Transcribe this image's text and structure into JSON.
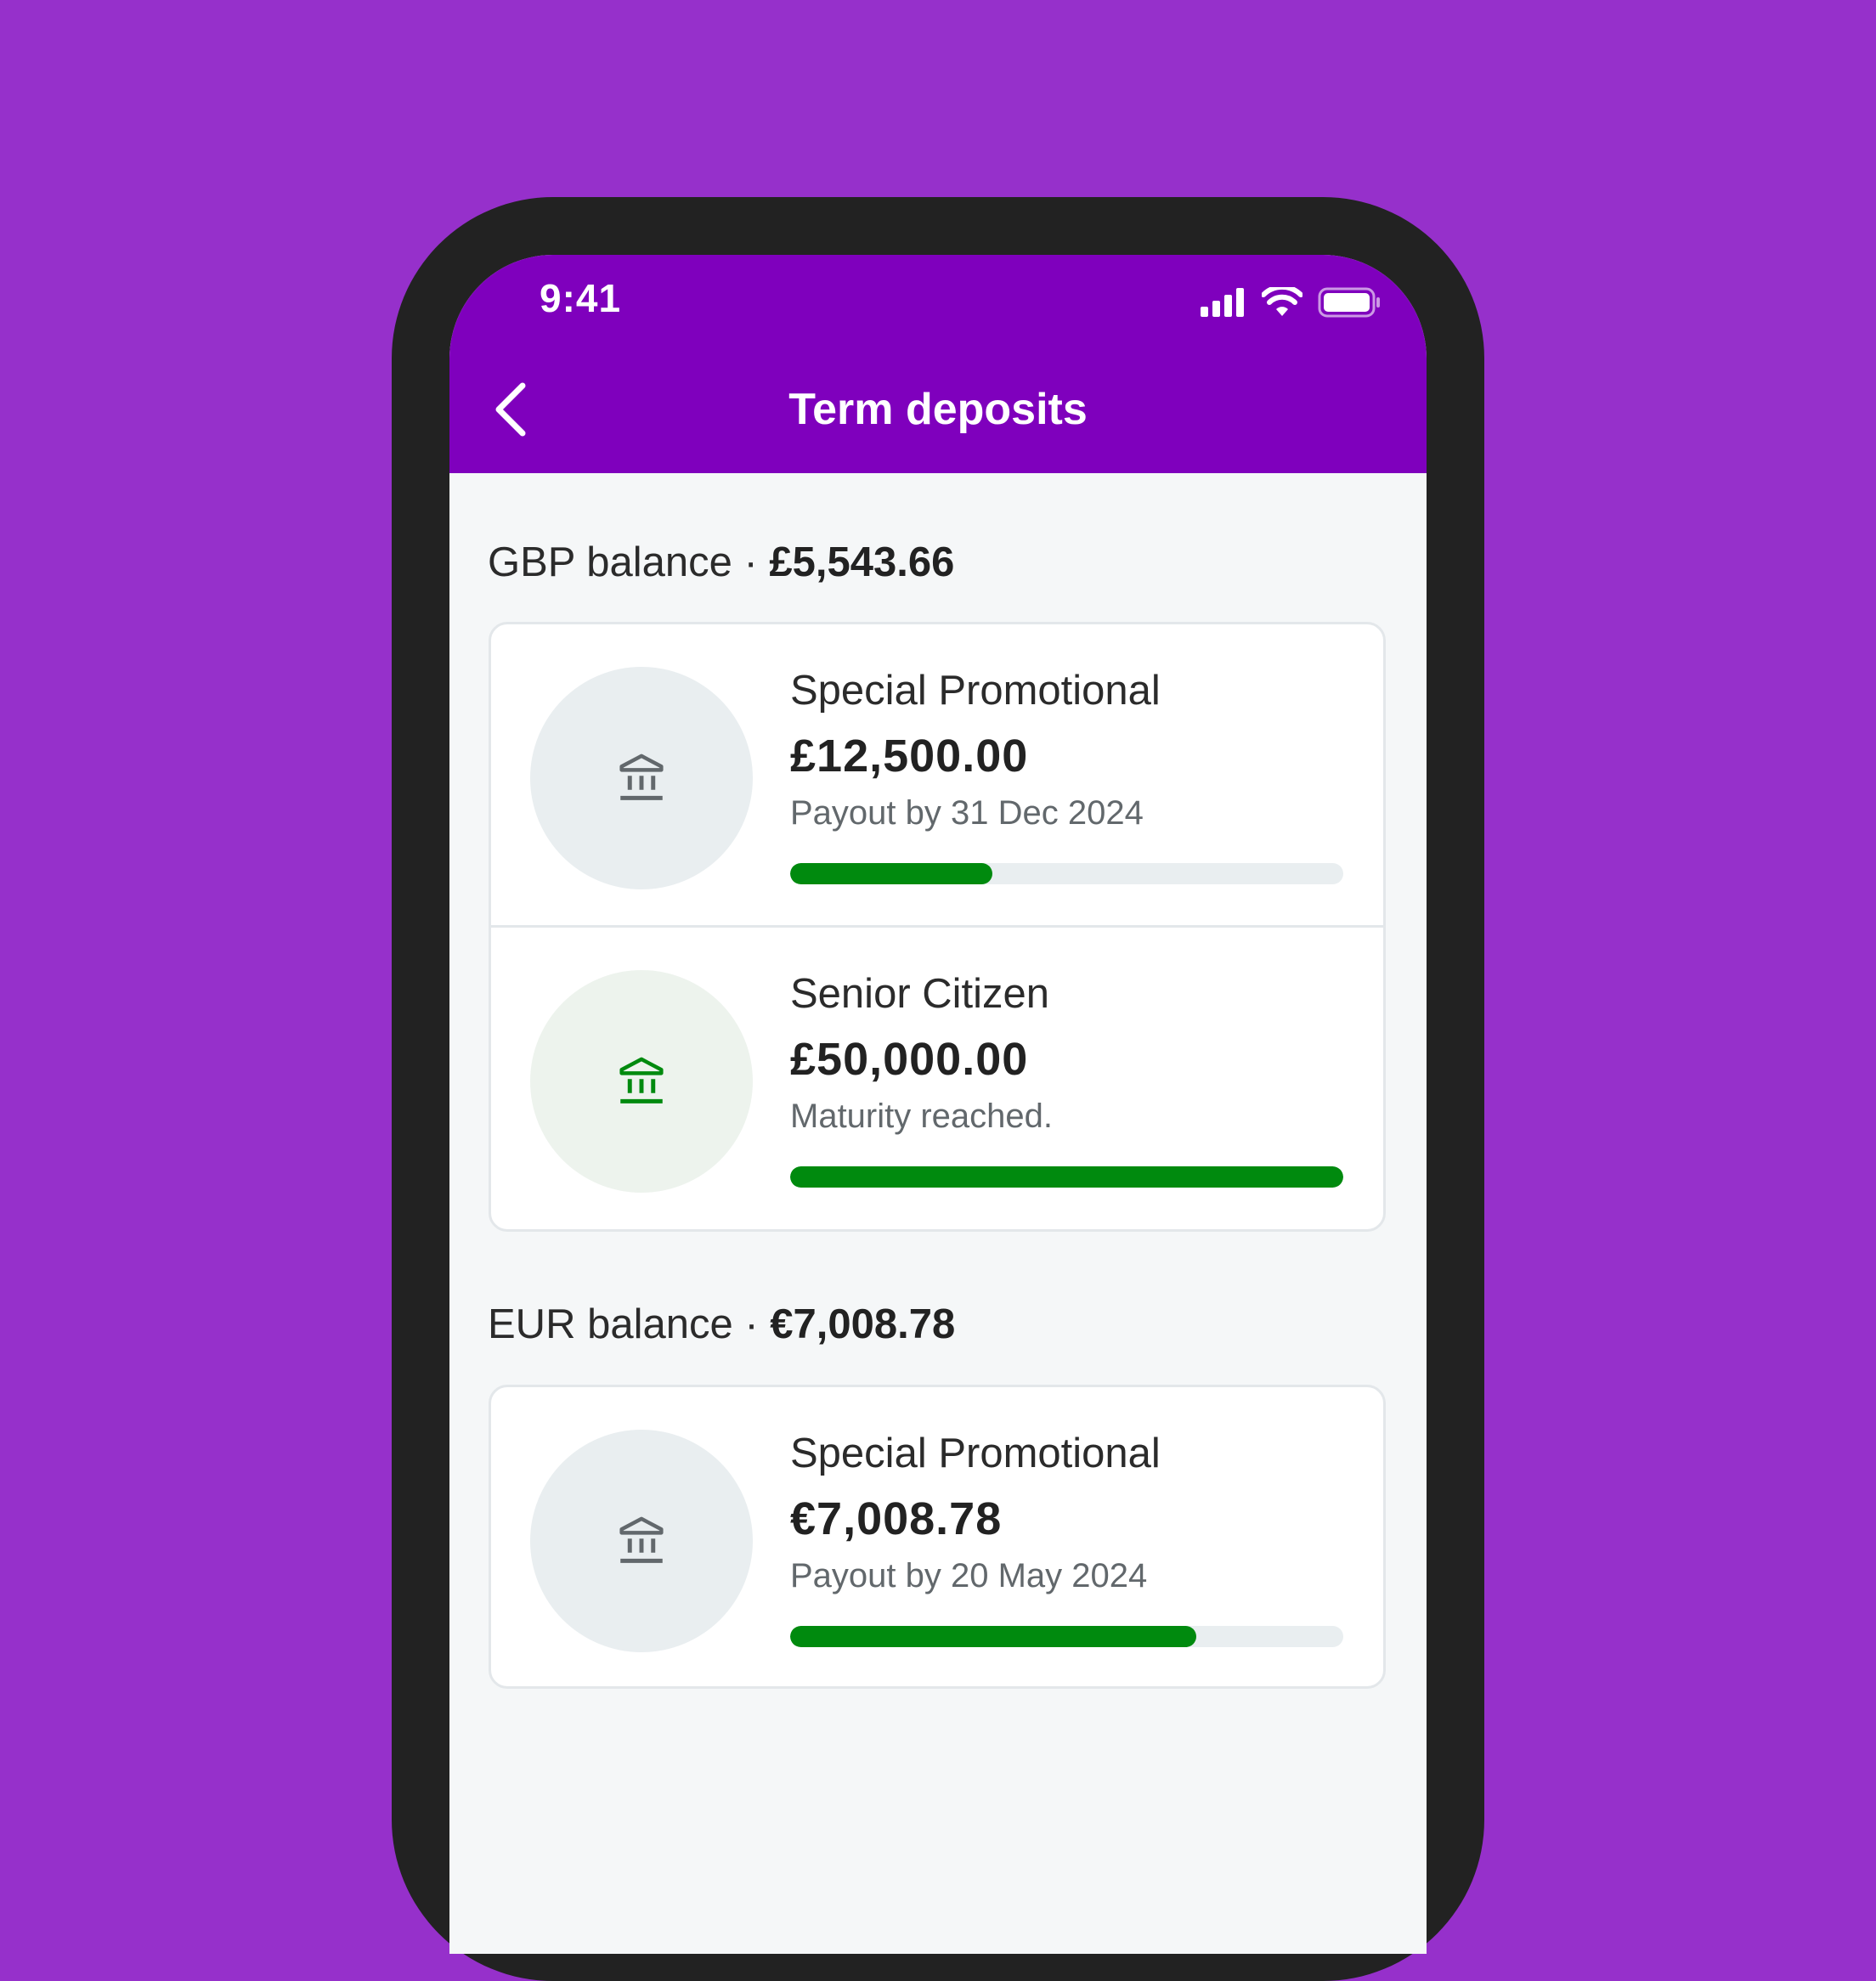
{
  "status_bar": {
    "time": "9:41"
  },
  "header": {
    "title": "Term deposits"
  },
  "sections": [
    {
      "label": "GBP balance ·",
      "amount": "£5,543.66",
      "deposits": [
        {
          "name": "Special Promotional",
          "amount": "£12,500.00",
          "note": "Payout by 31 Dec 2024",
          "progress": 0.365,
          "icon": "bank-icon",
          "icon_color": "#62686C",
          "circle_color": "#E9EEF0"
        },
        {
          "name": "Senior Citizen",
          "amount": "£50,000.00",
          "note": "Maturity reached.",
          "progress": 1.0,
          "icon": "bank-icon",
          "icon_color": "#008A0E",
          "circle_color": "#EDF3ED"
        }
      ]
    },
    {
      "label": "EUR balance ·",
      "amount": "€7,008.78",
      "deposits": [
        {
          "name": "Special Promotional",
          "amount": "€7,008.78",
          "note": "Payout by 20 May 2024",
          "progress": 0.735,
          "icon": "bank-icon",
          "icon_color": "#62686C",
          "circle_color": "#E9EEF0"
        }
      ]
    }
  ],
  "colors": {
    "background": "#9630CB",
    "app_bar": "#7F00BD",
    "progress": "#008A0E"
  }
}
